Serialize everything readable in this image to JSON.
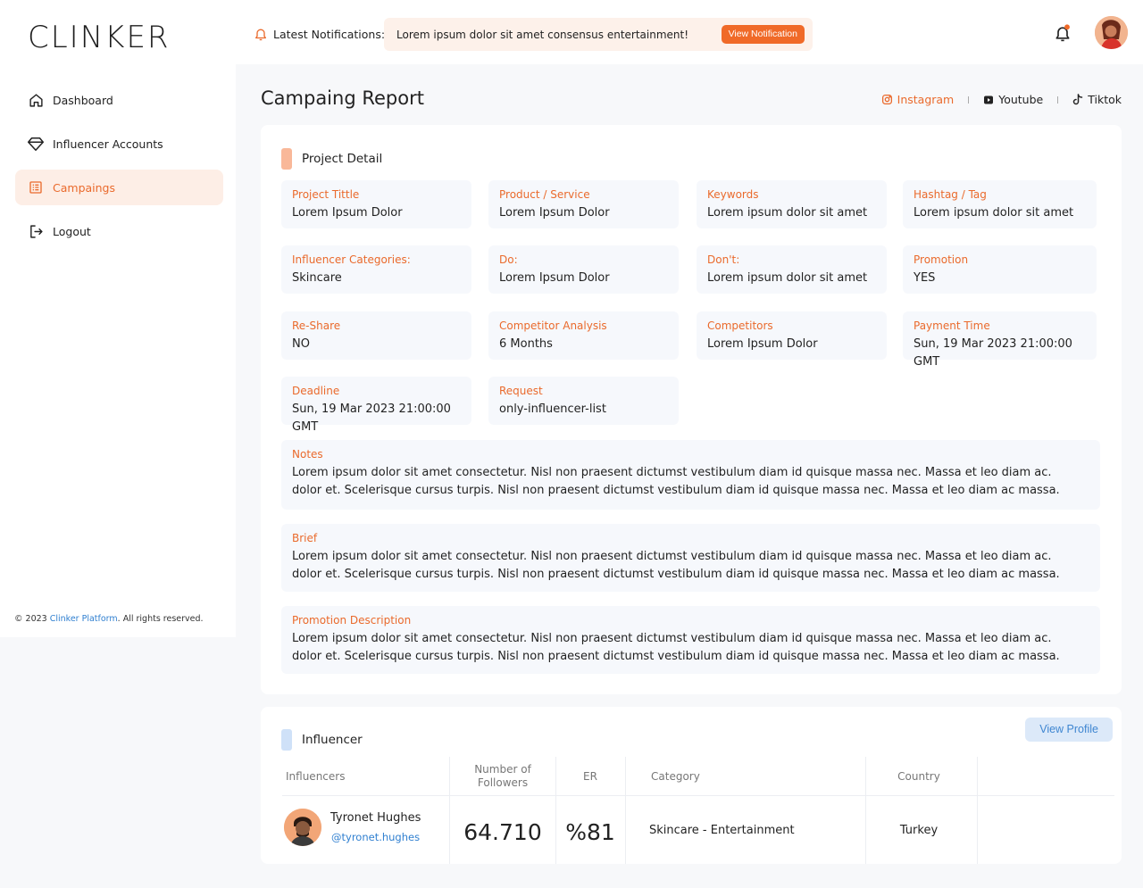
{
  "logo": "CLINKER",
  "sidebar": {
    "items": [
      {
        "label": "Dashboard",
        "icon": "home-icon"
      },
      {
        "label": "Influencer Accounts",
        "icon": "diamond-icon"
      },
      {
        "label": "Campaings",
        "icon": "list-icon",
        "active": true
      },
      {
        "label": "Logout",
        "icon": "logout-icon"
      }
    ],
    "footer_prefix": "© 2023 ",
    "footer_link": "Clinker Platform",
    "footer_suffix": ". All rights reserved."
  },
  "topbar": {
    "notif_label": "Latest Notifications:",
    "notif_text": "Lorem ipsum dolor sit amet consensus entertainment!",
    "notif_button": "View Notification"
  },
  "page": {
    "title": "Campaing Report",
    "socials": [
      {
        "label": "Instagram",
        "icon": "instagram-icon",
        "active": true
      },
      {
        "label": "Youtube",
        "icon": "youtube-icon"
      },
      {
        "label": "Tiktok",
        "icon": "tiktok-icon"
      }
    ]
  },
  "project": {
    "heading": "Project Detail",
    "fields": [
      {
        "label": "Project Tittle",
        "value": "Lorem Ipsum Dolor"
      },
      {
        "label": "Product / Service",
        "value": "Lorem Ipsum Dolor"
      },
      {
        "label": "Keywords",
        "value": "Lorem ipsum dolor sit amet"
      },
      {
        "label": "Hashtag / Tag",
        "value": "Lorem ipsum dolor sit amet"
      },
      {
        "label": "Influencer Categories:",
        "value": "Skincare"
      },
      {
        "label": "Do:",
        "value": "Lorem Ipsum Dolor"
      },
      {
        "label": "Don't:",
        "value": "Lorem ipsum dolor sit amet"
      },
      {
        "label": "Promotion",
        "value": "YES"
      },
      {
        "label": "Re-Share",
        "value": "NO"
      },
      {
        "label": "Competitor Analysis",
        "value": "6 Months"
      },
      {
        "label": "Competitors",
        "value": "Lorem Ipsum Dolor"
      },
      {
        "label": "Payment Time",
        "value": "Sun, 19 Mar 2023 21:00:00 GMT"
      },
      {
        "label": "Deadline",
        "value": "Sun, 19 Mar 2023 21:00:00 GMT"
      },
      {
        "label": "Request",
        "value": "only-influencer-list"
      }
    ],
    "wide": [
      {
        "label": "Notes",
        "line1": "Lorem ipsum dolor sit amet consectetur. Nisl non praesent dictumst vestibulum diam id quisque massa nec. Massa et leo diam ac.",
        "line2": "dolor et. Scelerisque cursus turpis. Nisl non praesent dictumst vestibulum diam id quisque massa nec. Massa et leo diam ac massa."
      },
      {
        "label": "Brief",
        "line1": "Lorem ipsum dolor sit amet consectetur. Nisl non praesent dictumst vestibulum diam id quisque massa nec. Massa et leo diam ac.",
        "line2": "dolor et. Scelerisque cursus turpis. Nisl non praesent dictumst vestibulum diam id quisque massa nec. Massa et leo diam ac massa."
      },
      {
        "label": "Promotion Description",
        "line1": "Lorem ipsum dolor sit amet consectetur. Nisl non praesent dictumst vestibulum diam id quisque massa nec. Massa et leo diam ac.",
        "line2": "dolor et. Scelerisque cursus turpis. Nisl non praesent dictumst vestibulum diam id quisque massa nec. Massa et leo diam ac massa."
      }
    ]
  },
  "influencer": {
    "heading": "Influencer",
    "view_profile": "View Profile",
    "headers": {
      "influencers": "Influencers",
      "followers_line1": "Number of",
      "followers_line2": "Followers",
      "er": "ER",
      "category": "Category",
      "country": "Country"
    },
    "row": {
      "name": "Tyronet Hughes",
      "handle": "@tyronet.hughes",
      "followers": "64.710",
      "er": "%81",
      "category": "Skincare - Entertainment",
      "country": "Turkey"
    }
  },
  "colors": {
    "accent": "#ea6a2c",
    "link": "#2f7fd0",
    "field_bg": "#f6f8fc"
  }
}
